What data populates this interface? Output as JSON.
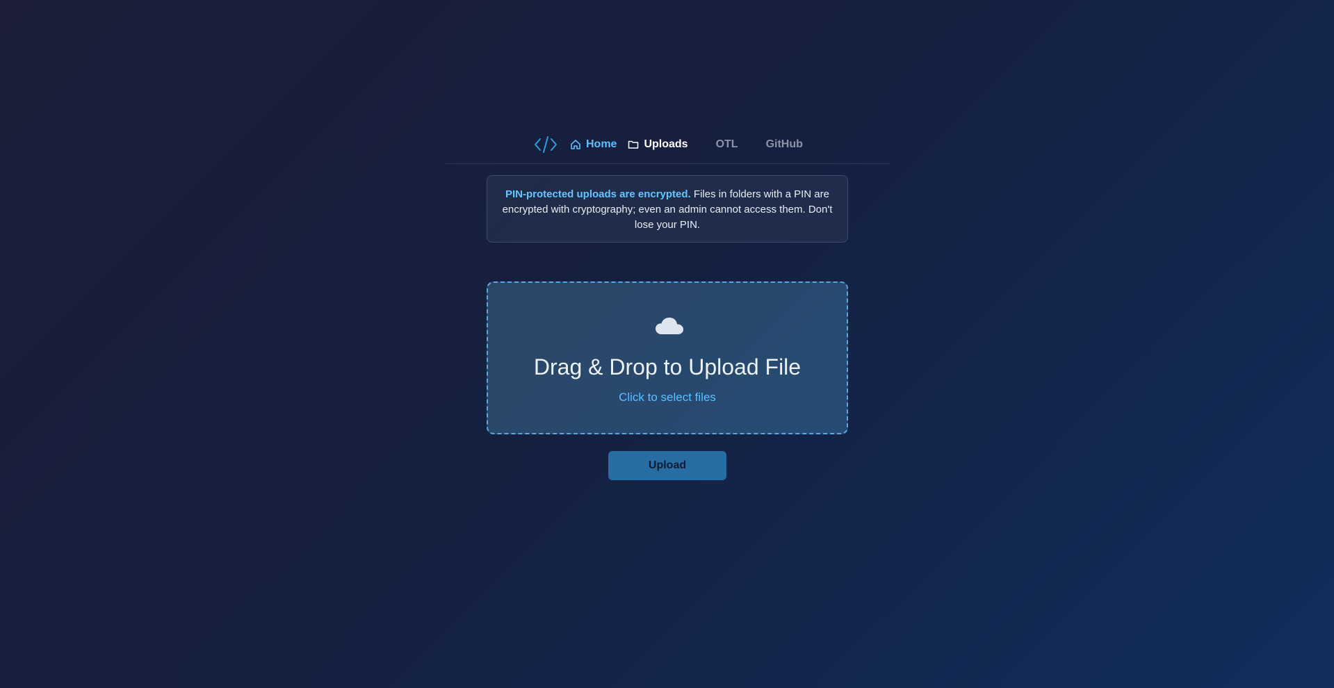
{
  "nav": {
    "logo_icon": "code-brackets-icon",
    "home_label": "Home",
    "home_icon": "home-icon",
    "uploads_label": "Uploads",
    "uploads_icon": "folder-icon",
    "otl_label": "OTL",
    "github_label": "GitHub"
  },
  "notice": {
    "bold_text": "PIN-protected uploads are encrypted.",
    "body_text": " Files in folders with a PIN are encrypted with cryptography; even an admin cannot access them. Don't lose your PIN."
  },
  "dropzone": {
    "icon": "cloud-icon",
    "title": "Drag & Drop to Upload File",
    "subtitle": "Click to select files"
  },
  "upload_button": {
    "label": "Upload"
  },
  "colors": {
    "accent": "#59c1ff",
    "button": "#266da3",
    "dropzone_border": "#5aa8e0"
  }
}
